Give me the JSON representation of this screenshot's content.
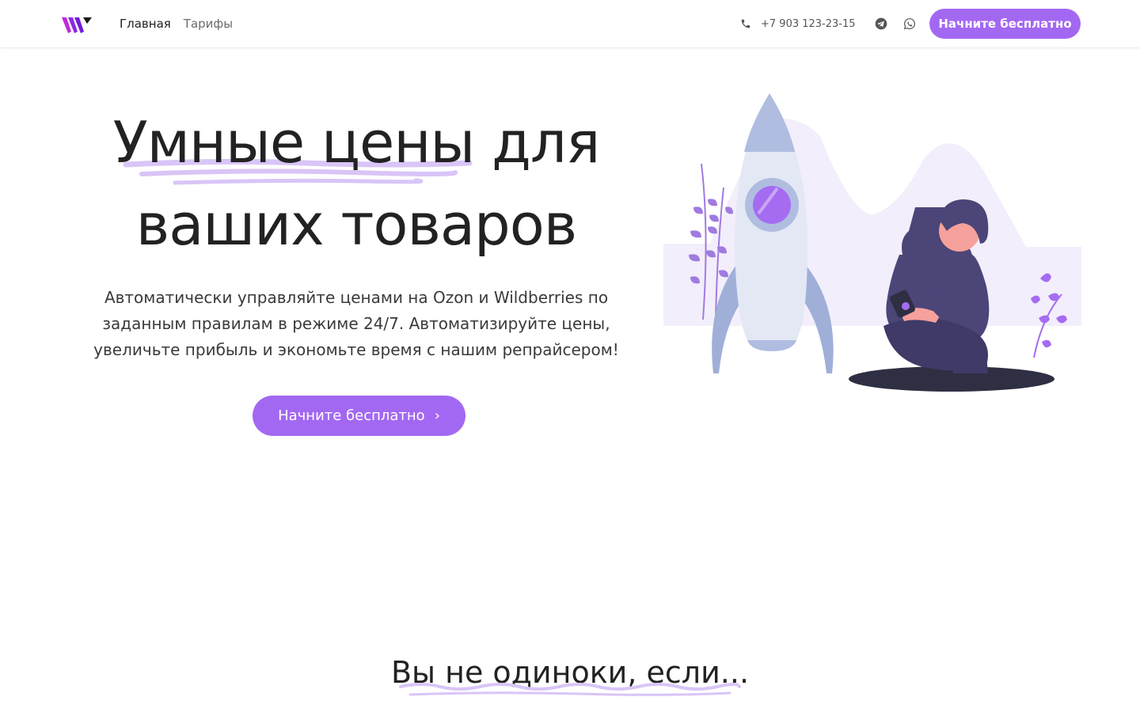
{
  "header": {
    "nav": [
      {
        "label": "Главная"
      },
      {
        "label": "Тарифы"
      }
    ],
    "phone": "+7 903 123-23-15",
    "cta_label": "Начните бесплатно",
    "icons": [
      "logo-icon",
      "phone-icon",
      "telegram-icon",
      "whatsapp-icon"
    ]
  },
  "hero": {
    "title_line1": "Умные цены для",
    "title_line2": "ваших товаров",
    "description": "Автоматически управляйте ценами на Ozon и Wildberries по заданным правилам в режиме 24/7.  Автоматизируйте цены, увеличьте прибыль и экономьте время с нашим репрайсером!",
    "cta_label": "Начните бесплатно",
    "cta_icon": "chevron-right-icon"
  },
  "section": {
    "title": "Вы не одиноки, если..."
  },
  "colors": {
    "accent": "#a368f2",
    "accent_light": "#d9c5f7",
    "text": "#222222",
    "rocket": "#b0bde0",
    "person_dark": "#4b4578"
  }
}
